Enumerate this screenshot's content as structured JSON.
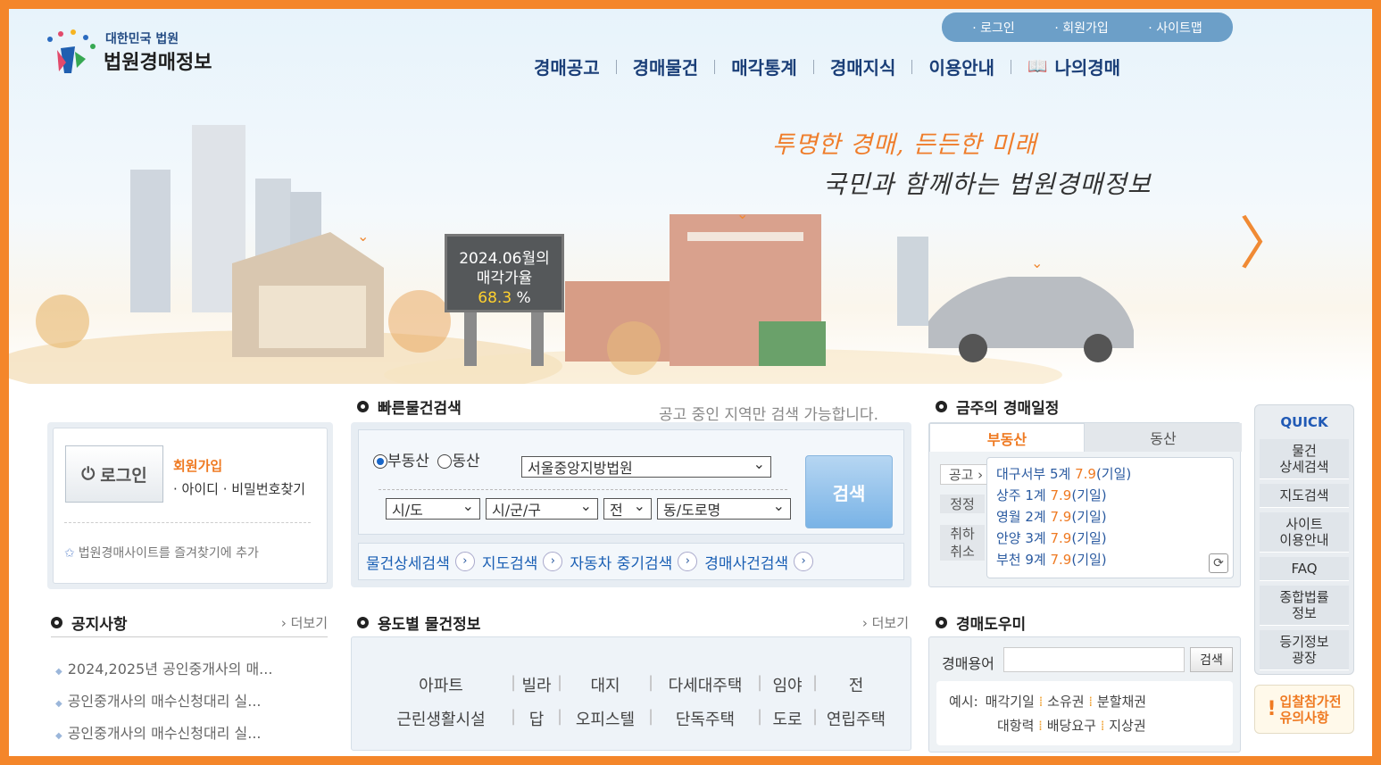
{
  "header": {
    "logo_small": "대한민국 법원",
    "logo_big": "법원경매정보",
    "util": [
      "· 로그인",
      "· 회원가입",
      "· 사이트맵"
    ],
    "gnb": [
      "경매공고",
      "경매물건",
      "매각통계",
      "경매지식",
      "이용안내",
      "나의경매"
    ]
  },
  "banner": {
    "slogan1": "투명한 경매, 든든한 미래",
    "slogan2": "국민과 함께하는 법원경매정보",
    "board_line1": "2024.06월의",
    "board_line2": "매각가율",
    "board_value": "68.3",
    "board_unit": "%",
    "next_glyph": "〉"
  },
  "login": {
    "button": "로그인",
    "join": "회원가입",
    "find": "· 아이디 · 비밀번호찾기",
    "favorite": "법원경매사이트를 즐겨찾기에 추가"
  },
  "notice": {
    "title": "공지사항",
    "more": "› 더보기",
    "items": [
      "2024,2025년 공인중개사의 매...",
      "공인중개사의 매수신청대리 실...",
      "공인중개사의 매수신청대리 실..."
    ]
  },
  "quick_search": {
    "title": "빠른물건검색",
    "note": "공고 중인 지역만 검색 가능합니다.",
    "radio1": "부동산",
    "radio2": "동산",
    "court": "서울중앙지방법원",
    "sido": "시/도",
    "sigungu": "시/군/구",
    "jeon": "전",
    "dong": "동/도로명",
    "search": "검색",
    "links": [
      "물건상세검색",
      "지도검색",
      "자동차 중기검색",
      "경매사건검색"
    ]
  },
  "use_info": {
    "title": "용도별 물건정보",
    "more": "› 더보기",
    "row1": [
      "아파트",
      "빌라",
      "대지",
      "다세대주택",
      "임야",
      "전"
    ],
    "row2": [
      "근린생활시설",
      "답",
      "오피스텔",
      "단독주택",
      "도로",
      "연립주택"
    ]
  },
  "schedule": {
    "title": "금주의 경매일정",
    "tab1": "부동산",
    "tab2": "동산",
    "tags": [
      "공고 ›",
      "정정",
      "취하\n취소"
    ],
    "items": [
      {
        "court": "대구서부 5계 ",
        "date": "7.9",
        "type": "(기일)"
      },
      {
        "court": "상주 1계 ",
        "date": "7.9",
        "type": "(기일)"
      },
      {
        "court": "영월 2계 ",
        "date": "7.9",
        "type": "(기일)"
      },
      {
        "court": "안양 3계 ",
        "date": "7.9",
        "type": "(기일)"
      },
      {
        "court": "부천 9계 ",
        "date": "7.9",
        "type": "(기일)"
      }
    ]
  },
  "help": {
    "title": "경매도우미",
    "label": "경매용어",
    "search": "검색",
    "example_label": "예시:",
    "examples1": [
      "매각기일",
      "소유권",
      "분할채권"
    ],
    "examples2": [
      "대항력",
      "배당요구",
      "지상권"
    ]
  },
  "quick_menu": {
    "title": "QUICK",
    "items": [
      "물건\n상세검색",
      "지도검색",
      "사이트\n이용안내",
      "FAQ",
      "종합법률\n정보",
      "등기정보\n광장"
    ],
    "caution": "입찰참가전\n유의사항"
  }
}
